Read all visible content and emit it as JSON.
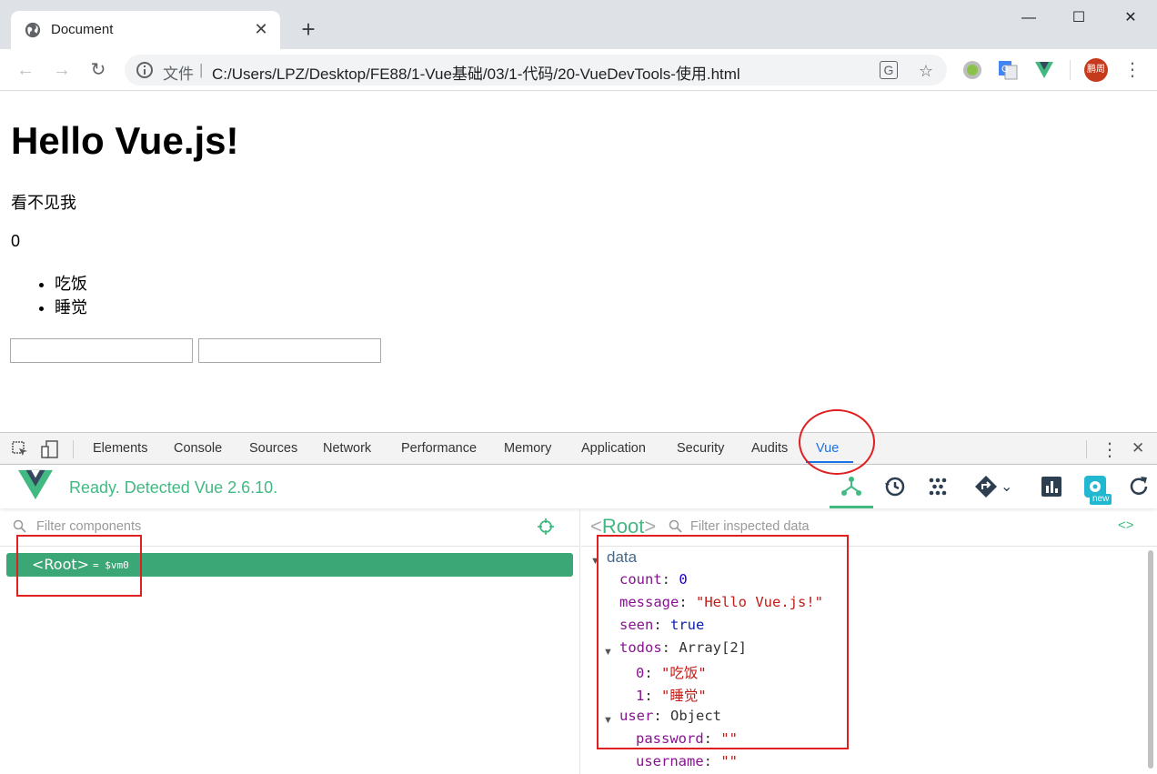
{
  "browser": {
    "tab_title": "Document",
    "omnibox": {
      "prefix": "文件",
      "separator": "|",
      "url": "C:/Users/LPZ/Desktop/FE88/1-Vue基础/03/1-代码/20-VueDevTools-使用.html"
    },
    "avatar_text": "鹏周"
  },
  "page": {
    "heading": "Hello Vue.js!",
    "paragraph1": "看不见我",
    "paragraph2": "0",
    "list": [
      "吃饭",
      "睡觉"
    ]
  },
  "devtools": {
    "tabs": [
      "Elements",
      "Console",
      "Sources",
      "Network",
      "Performance",
      "Memory",
      "Application",
      "Security",
      "Audits",
      "Vue"
    ],
    "active_tab": "Vue",
    "vue": {
      "status": "Ready. Detected Vue 2.6.10.",
      "new_badge": "new",
      "filter_components_placeholder": "Filter components",
      "filter_data_placeholder": "Filter inspected data",
      "root_tag": "<Root>",
      "root_vm": "= $vm0",
      "inspected_name": "Root",
      "data_section": "data",
      "fields": {
        "count": {
          "key": "count",
          "value": "0"
        },
        "message": {
          "key": "message",
          "value": "\"Hello Vue.js!\""
        },
        "seen": {
          "key": "seen",
          "value": "true"
        },
        "todos": {
          "key": "todos",
          "type": "Array[2]",
          "items": [
            {
              "key": "0",
              "value": "\"吃饭\""
            },
            {
              "key": "1",
              "value": "\"睡觉\""
            }
          ]
        },
        "user": {
          "key": "user",
          "type": "Object",
          "items": [
            {
              "key": "password",
              "value": "\"\""
            },
            {
              "key": "username",
              "value": "\"\""
            }
          ]
        }
      }
    }
  },
  "colors": {
    "vue_green": "#42b983",
    "root_bg": "#3ba776",
    "annotation_red": "#e02020",
    "active_blue": "#1a73e8"
  }
}
